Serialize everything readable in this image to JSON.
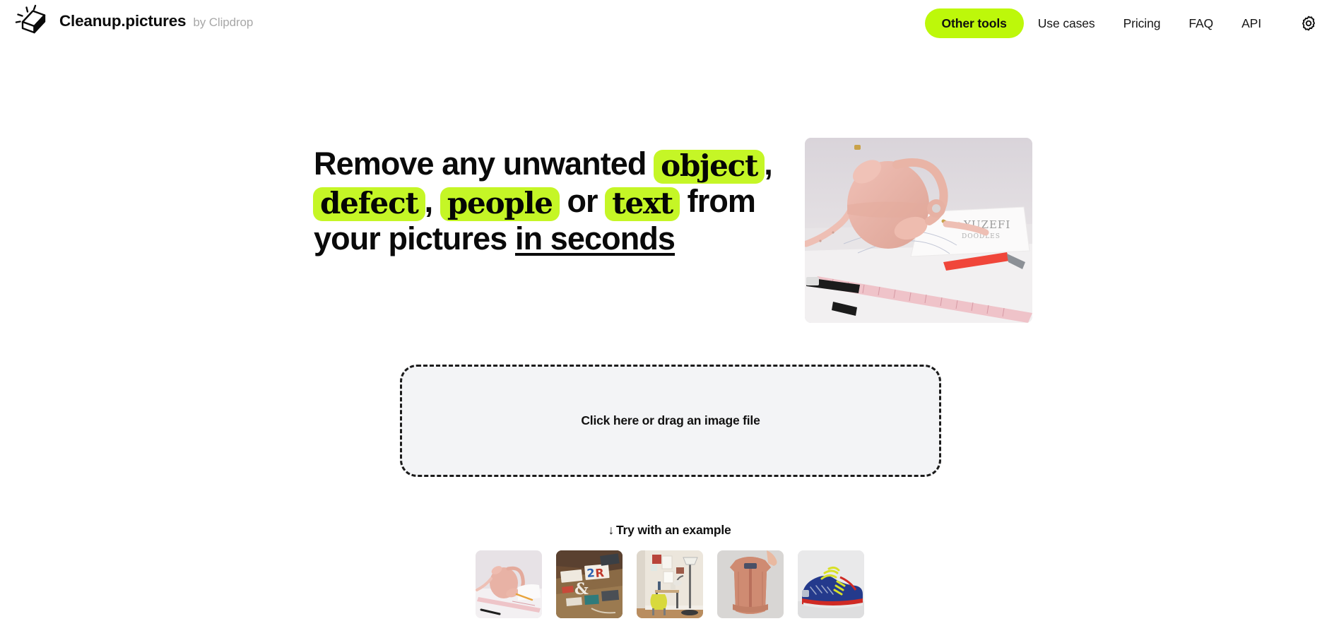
{
  "brand": {
    "logo_icon": "eraser-sparkle-icon",
    "name": "Cleanup.pictures",
    "byline": "by Clipdrop"
  },
  "nav": {
    "other_tools_label": "Other tools",
    "links": [
      {
        "label": "Use cases"
      },
      {
        "label": "Pricing"
      },
      {
        "label": "FAQ"
      },
      {
        "label": "API"
      }
    ],
    "settings_icon": "gear-icon"
  },
  "hero": {
    "headline": {
      "part1": "Remove any unwanted",
      "highlight1": "object",
      "sep1": ",",
      "highlight2": "defect",
      "sep2": ",",
      "highlight3": "people",
      "connector": "or",
      "highlight4": "text",
      "part2": "from your pictures",
      "emphasis": "in seconds"
    },
    "image_alt": "pink leather handbag on white desk with ruler pens and sketches"
  },
  "dropzone": {
    "label": "Click here or drag an image file"
  },
  "examples": {
    "title_arrow": "↓",
    "title": "Try with an example",
    "items": [
      {
        "name": "pink-handbag-desk"
      },
      {
        "name": "workshop-letters-table"
      },
      {
        "name": "room-yellow-chair-lamp"
      },
      {
        "name": "salmon-bomber-jacket"
      },
      {
        "name": "blue-yellow-sneaker"
      }
    ]
  },
  "colors": {
    "accent_green": "#bdf80a",
    "highlight_green": "#c5f626",
    "text_dark": "#0a0a0a",
    "muted_gray": "#a8a8a8",
    "dropzone_bg": "#f3f4f6"
  }
}
